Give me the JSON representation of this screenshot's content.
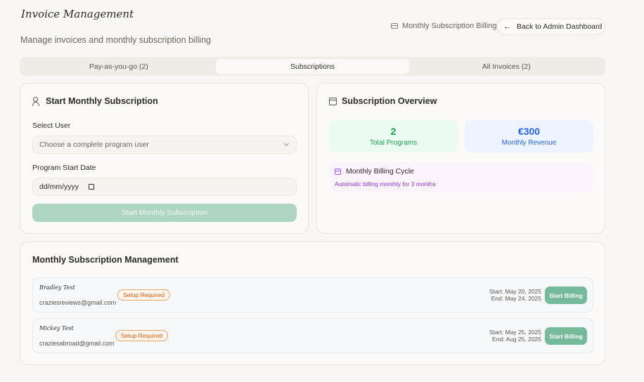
{
  "header": {
    "title": "Invoice Management",
    "subtitle": "Manage invoices and monthly subscription billing",
    "link_label": "Monthly Subscription Billing",
    "link_icon": "credit-card-icon",
    "back_label": "Back to Admin Dashboard",
    "back_icon": "arrow-left-icon"
  },
  "tabs": [
    {
      "label": "Pay-as-you-go (2)",
      "active": false
    },
    {
      "label": "Subscriptions",
      "active": true
    },
    {
      "label": "All Invoices (2)",
      "active": false
    }
  ],
  "start_form": {
    "title": "Start Monthly Subscription",
    "icon": "users-icon",
    "select_label": "Select User",
    "select_placeholder": "Choose a complete program user",
    "date_label": "Program Start Date",
    "date_placeholder": "dd/mm/yyyy",
    "submit_label": "Start Monthly Subscription",
    "submit_color": "#aed5c2"
  },
  "overview": {
    "title": "Subscription Overview",
    "icon": "calendar-icon",
    "total_programs": {
      "value": "2",
      "label": "Total Programs",
      "color": "#16a34a"
    },
    "monthly_revenue": {
      "value": "€300",
      "label": "Monthly Revenue",
      "color": "#2563eb"
    },
    "cycle": {
      "title": "Monthly Billing Cycle",
      "description": "Automatic billing monthly for 3 months",
      "color": "#9333ea"
    }
  },
  "management": {
    "title": "Monthly Subscription Management",
    "rows": [
      {
        "name": "Bradley Test",
        "email": "craziesreviews@gmail.com",
        "badge": "Setup Required",
        "start": "Start: May 20, 2025",
        "end": "End: May 24, 2025",
        "button": "Start Billing"
      },
      {
        "name": "Mickey Test",
        "email": "craziesabroad@gmail.com",
        "badge": "Setup Required",
        "start": "Start: May 25, 2025",
        "end": "End: Aug 25, 2025",
        "button": "Start Billing"
      }
    ],
    "button_color": "#76bb99",
    "badge_color": "#ea580c"
  }
}
